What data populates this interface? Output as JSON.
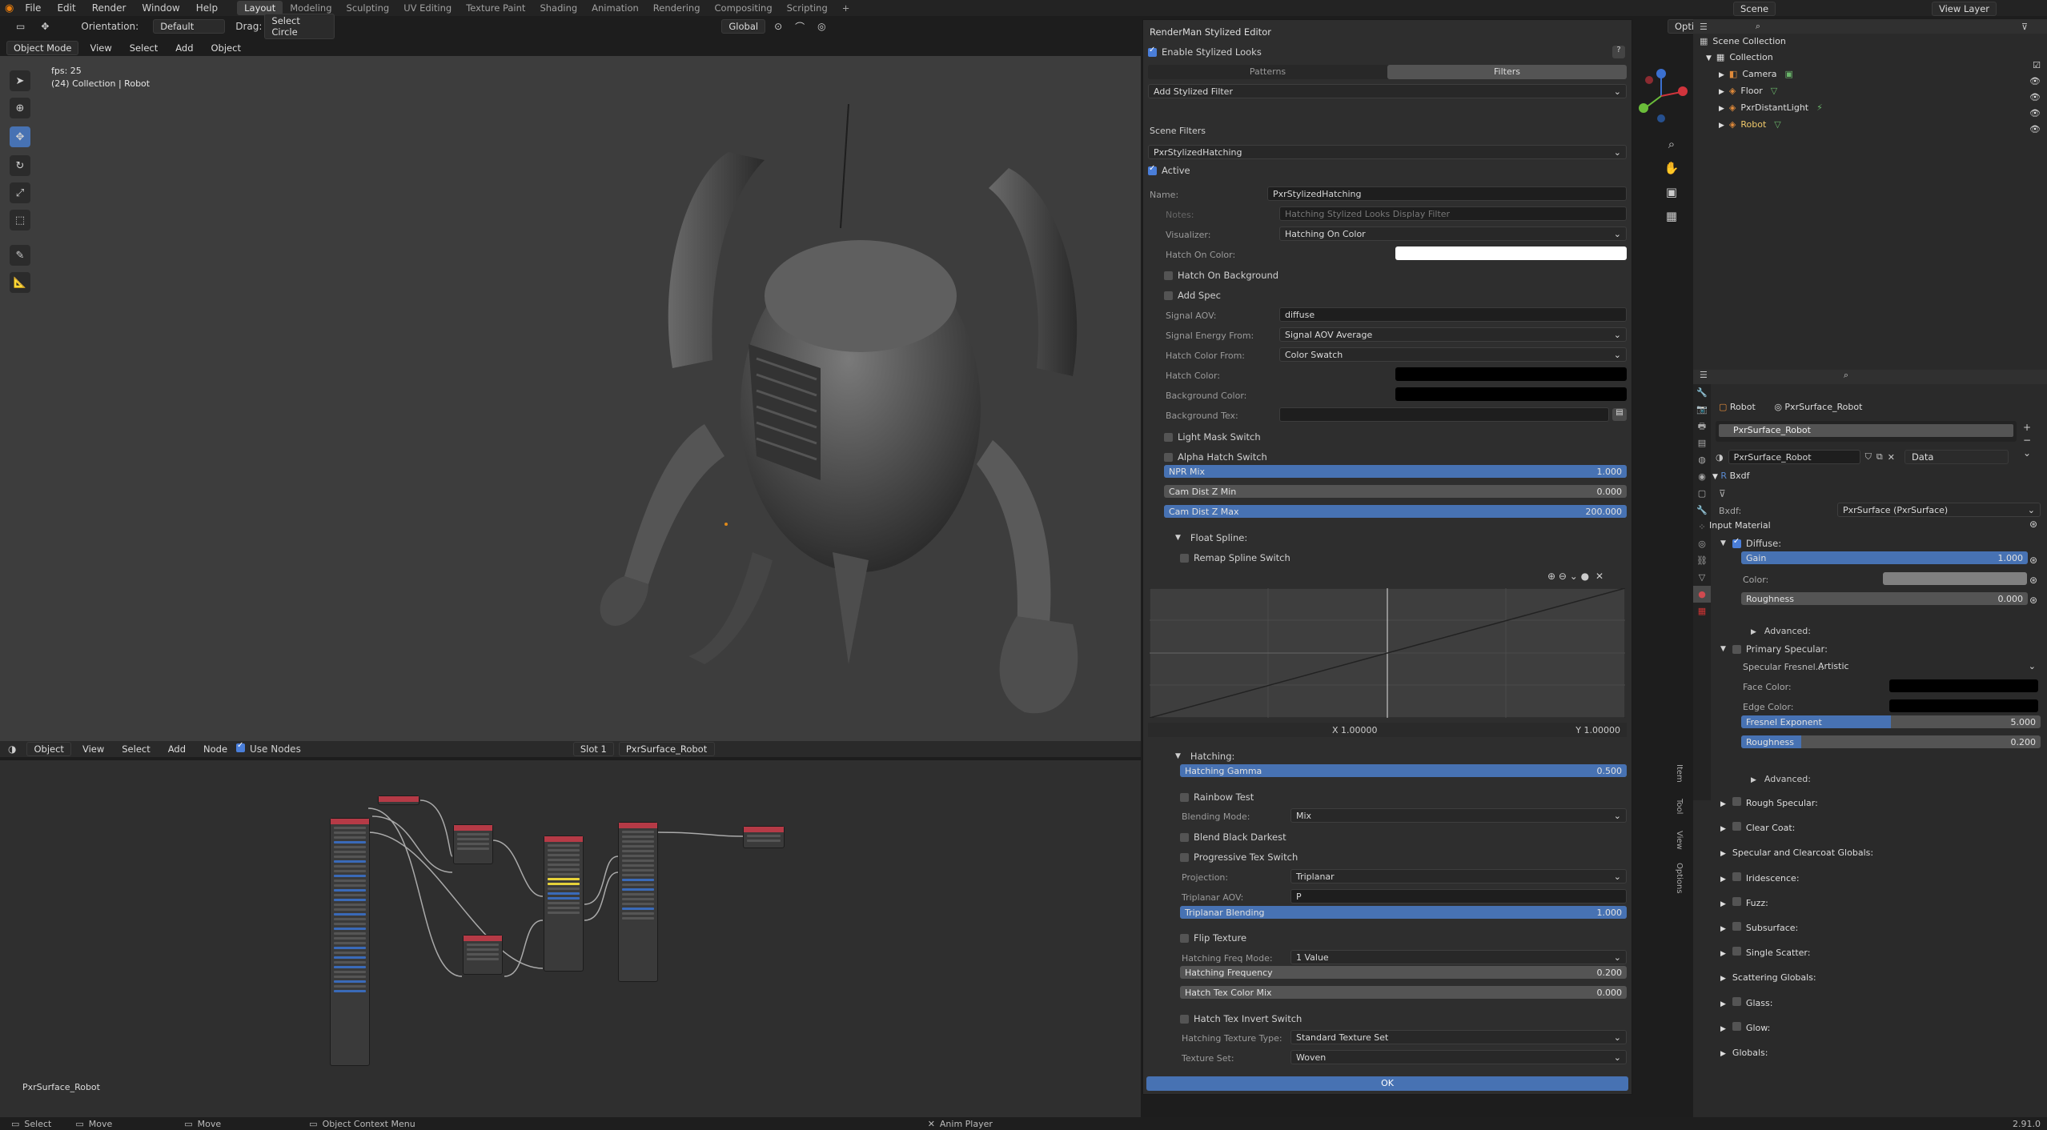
{
  "menu": [
    "File",
    "Edit",
    "Render",
    "Window",
    "Help"
  ],
  "workspaces": [
    "Layout",
    "Modeling",
    "Sculpting",
    "UV Editing",
    "Texture Paint",
    "Shading",
    "Animation",
    "Rendering",
    "Compositing",
    "Scripting",
    "+"
  ],
  "scene": "Scene",
  "view_layer": "View Layer",
  "header": {
    "orientation_label": "Orientation:",
    "orientation": "Default",
    "drag_label": "Drag:",
    "drag": "Select Circle",
    "global": "Global",
    "options": "Options"
  },
  "viewport_header": {
    "mode": "Object Mode",
    "items": [
      "View",
      "Select",
      "Add",
      "Object"
    ]
  },
  "viewport": {
    "fps": "fps: 25",
    "collection": "(24) Collection | Robot"
  },
  "node_editor": {
    "type": "Object",
    "items": [
      "View",
      "Select",
      "Add",
      "Node"
    ],
    "use_nodes": "Use Nodes",
    "slot": "Slot 1",
    "material": "PxrSurface_Robot",
    "footer": "PxrSurface_Robot"
  },
  "dialog": {
    "title": "RenderMan Stylized Editor",
    "enable": "Enable Stylized Looks",
    "tabs": [
      "Patterns",
      "Filters"
    ],
    "add_filter": "Add Stylized Filter",
    "scene_filters": "Scene Filters",
    "filter": "PxrStylizedHatching",
    "active": "Active",
    "name_label": "Name:",
    "name": "PxrStylizedHatching",
    "notes_label": "Notes:",
    "notes": "Hatching Stylized Looks Display Filter",
    "visualizer_label": "Visualizer:",
    "visualizer": "Hatching On Color",
    "hatch_on_color_label": "Hatch On Color:",
    "hatch_on_bg": "Hatch On Background",
    "add_spec": "Add Spec",
    "signal_aov_label": "Signal AOV:",
    "signal_aov": "diffuse",
    "signal_energy_label": "Signal Energy From:",
    "signal_energy": "Signal AOV Average",
    "hatch_color_from_label": "Hatch Color From:",
    "hatch_color_from": "Color Swatch",
    "hatch_color_label": "Hatch Color:",
    "bg_color_label": "Background Color:",
    "bg_tex_label": "Background Tex:",
    "light_mask": "Light Mask Switch",
    "alpha_hatch": "Alpha Hatch Switch",
    "npr_mix": {
      "label": "NPR Mix",
      "value": "1.000",
      "frac": 1.0
    },
    "cam_min": {
      "label": "Cam Dist Z Min",
      "value": "0.000",
      "frac": 0.0
    },
    "cam_max": {
      "label": "Cam Dist Z Max",
      "value": "200.000",
      "frac": 1.0
    },
    "float_spline": "Float Spline:",
    "remap": "Remap Spline Switch",
    "spline_x": "X 1.00000",
    "spline_y": "Y 1.00000",
    "hatching": "Hatching:",
    "gamma": {
      "label": "Hatching Gamma",
      "value": "0.500",
      "frac": 1.0
    },
    "rainbow": "Rainbow Test",
    "blend_label": "Blending Mode:",
    "blend": "Mix",
    "blend_darkest": "Blend Black Darkest",
    "progressive": "Progressive Tex Switch",
    "projection_label": "Projection:",
    "projection": "Triplanar",
    "triplanar_aov_label": "Triplanar AOV:",
    "triplanar_aov": "P",
    "triplanar_blending": {
      "label": "Triplanar Blending",
      "value": "1.000",
      "frac": 1.0
    },
    "flip": "Flip Texture",
    "freq_mode_label": "Hatching Freq Mode:",
    "freq_mode": "1 Value",
    "freq": {
      "label": "Hatching Frequency",
      "value": "0.200",
      "frac": 0.0
    },
    "tex_color_mix": {
      "label": "Hatch Tex Color Mix",
      "value": "0.000",
      "frac": 0.0
    },
    "invert": "Hatch Tex Invert Switch",
    "tex_type_label": "Hatching Texture Type:",
    "tex_type": "Standard Texture Set",
    "tex_set_label": "Texture Set:",
    "tex_set": "Woven",
    "ok": "OK"
  },
  "outliner": {
    "root": "Scene Collection",
    "collection": "Collection",
    "items": [
      "Camera",
      "Floor",
      "PxrDistantLight",
      "Robot"
    ]
  },
  "properties": {
    "object": "Robot",
    "material": "PxrSurface_Robot",
    "slot": "PxrSurface_Robot",
    "mat_name": "PxrSurface_Robot",
    "link": "Data",
    "bxdf_section": "Bxdf",
    "bxdf_label": "Bxdf:",
    "bxdf": "PxrSurface (PxrSurface)",
    "input_material": "Input Material",
    "diffuse": "Diffuse:",
    "gain": {
      "label": "Gain",
      "value": "1.000",
      "frac": 1.0
    },
    "color_label": "Color:",
    "roughness": {
      "label": "Roughness",
      "value": "0.000",
      "frac": 0.0
    },
    "advanced": "Advanced:",
    "primary_spec": "Primary Specular:",
    "spec_fresnel_label": "Specular Fresnel...",
    "spec_fresnel": "Artistic",
    "face_color": "Face Color:",
    "edge_color": "Edge Color:",
    "fresnel_exp": {
      "label": "Fresnel Exponent",
      "value": "5.000",
      "frac": 0.5
    },
    "spec_rough": {
      "label": "Roughness",
      "value": "0.200",
      "frac": 0.2
    },
    "advanced2": "Advanced:",
    "sections": [
      "Rough Specular:",
      "Clear Coat:",
      "Specular and Clearcoat Globals:",
      "Iridescence:",
      "Fuzz:",
      "Subsurface:",
      "Single Scatter:",
      "Scattering Globals:",
      "Glass:",
      "Glow:",
      "Globals:"
    ]
  },
  "sidebar_tabs": [
    "Item",
    "Tool",
    "View",
    "Options"
  ],
  "status": {
    "select": "Select",
    "move": "Move",
    "move2": "Move",
    "context": "Object Context Menu",
    "anim": "Anim Player",
    "version": "2.91.0"
  },
  "colors": {
    "accent": "#4772b3",
    "node_header": "#b53a46"
  }
}
